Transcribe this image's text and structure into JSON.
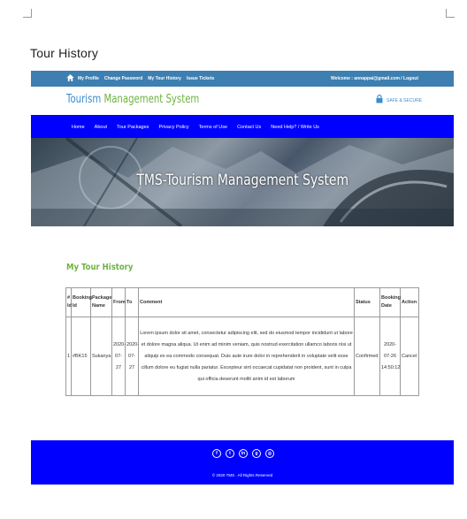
{
  "doc_heading": "Tour History",
  "topbar": {
    "links": [
      "My Profile",
      "Change Password",
      "My Tour History",
      "Issue Tickets"
    ],
    "welcome": "Welcome : annappai@gmail.com / Logout"
  },
  "brand": {
    "part1": "Tourism ",
    "part2": "Management System",
    "safe": "SAFE & SECURE"
  },
  "nav": [
    "Home",
    "About",
    "Tour Packages",
    "Privacy Policy",
    "Terms of Use",
    "Contact Us",
    "Need Help? / Write Us"
  ],
  "banner": {
    "title": "TMS-Tourism Management System"
  },
  "section_title": "My Tour History",
  "table": {
    "headers": [
      "# Id",
      "Booking Id",
      "Package Name",
      "From",
      "To",
      "Comment",
      "Status",
      "Booking Date",
      "Action"
    ],
    "rows": [
      {
        "id": "1",
        "booking_id": "#BK15",
        "package": "Sukanya",
        "from": "2020-07-27",
        "to": "2020-07-27",
        "comment": "Lorem ipsum dolor sit amet, consectetur adipiscing elit, sed do eiusmod tempor incididunt ut labore et dolore magna aliqua. Ut enim ad minim veniam, quis nostrud exercitation ullamco laboris nisi ut aliquip ex ea commodo consequat. Duis aute irure dolor in reprehenderit in voluptate velit esse cillum dolore eu fugiat nulla pariatur. Excepteur sint occaecat cupidatat non proident, sunt in culpa qui officia deserunt mollit anim id est laborum",
        "status": "Confirmed",
        "booking_date": "2020-07-26 14:50:12",
        "action": "Cancel"
      }
    ]
  },
  "footer": {
    "social_icons": [
      "facebook-icon",
      "twitter-icon",
      "linkedin-icon",
      "google-plus-icon",
      "instagram-icon"
    ],
    "copyright": "© 2020 TMS . All Rights Reserved"
  },
  "colors": {
    "topbar": "#3d7fb1",
    "nav": "#0000ff",
    "footer": "#0000ff",
    "accent_green": "#6db33f",
    "brand_blue": "#3d8ccc"
  }
}
